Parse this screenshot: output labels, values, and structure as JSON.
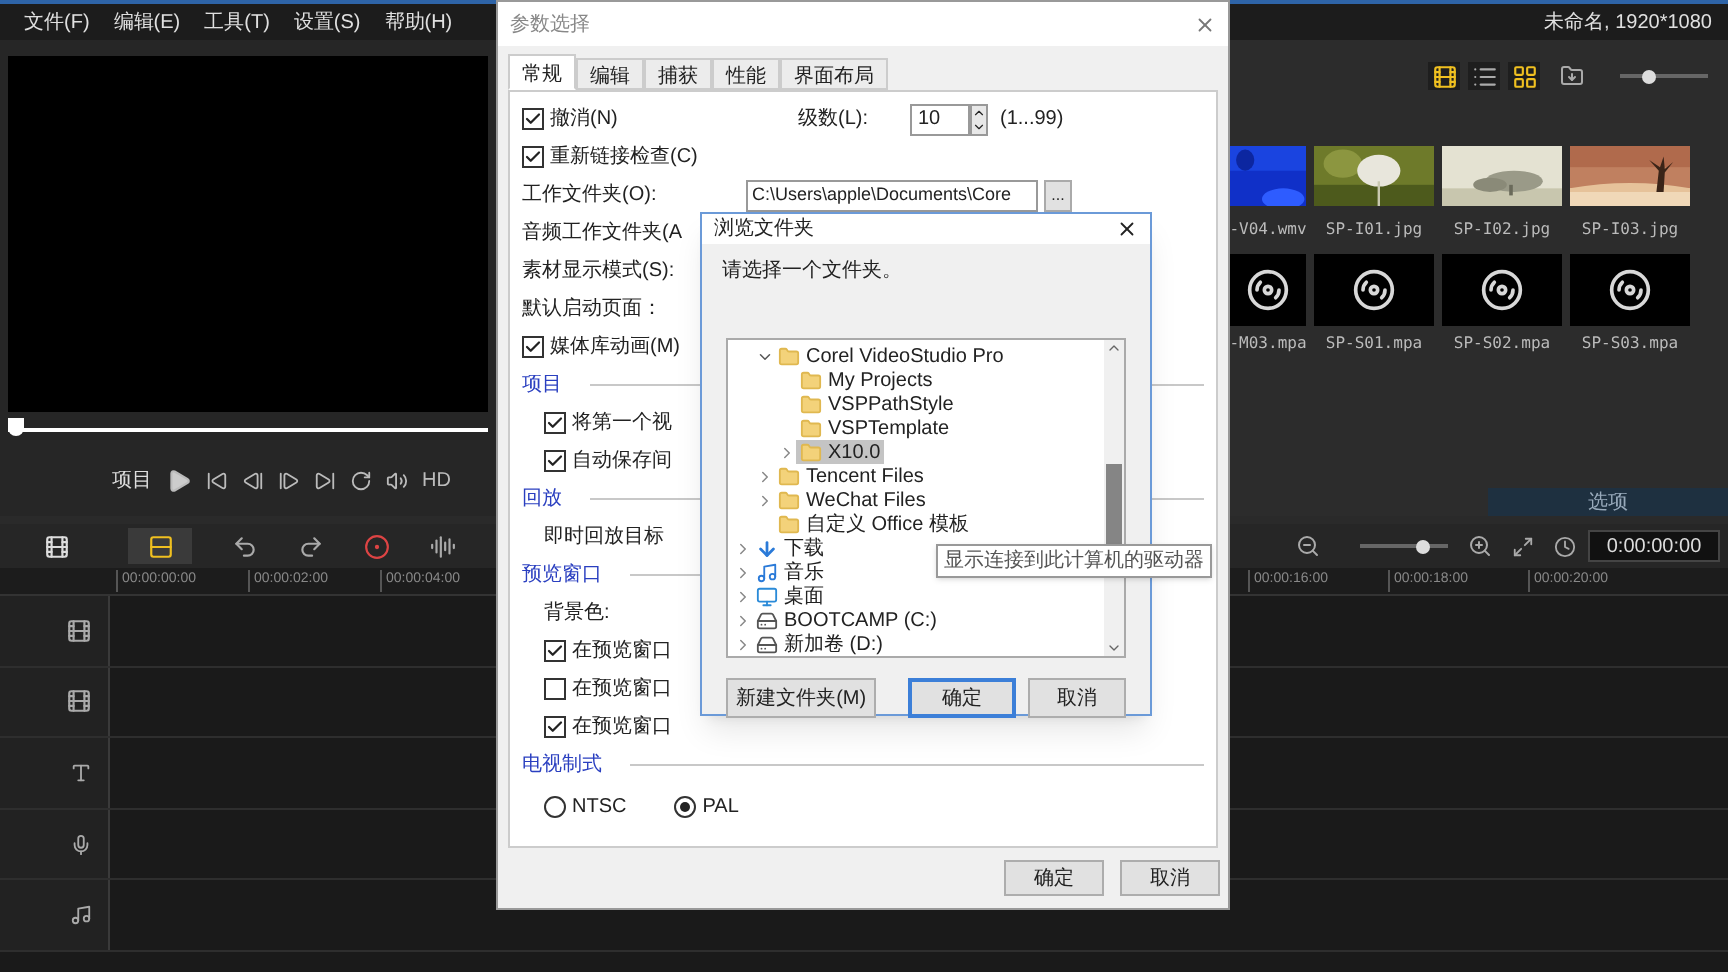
{
  "menu": [
    "文件(F)",
    "编辑(E)",
    "工具(T)",
    "设置(S)",
    "帮助(H)"
  ],
  "project_info": "未命名, 1920*1080",
  "preview": {
    "scrubber": {
      "level": 0
    },
    "mode_label": "项目",
    "hd_label": "HD"
  },
  "library": {
    "view_buttons": [
      {
        "kind": "storyboard",
        "selected": true
      },
      {
        "kind": "list",
        "selected": false
      },
      {
        "kind": "grid",
        "selected": true
      }
    ],
    "thumb_slider": {
      "level": 0.3
    },
    "items": [
      {
        "kind": "video",
        "label": "-V04.wmv"
      },
      {
        "label": "SP-I01.jpg"
      },
      {
        "label": "SP-I02.jpg"
      },
      {
        "label": "SP-I03.jpg"
      },
      {
        "kind": "audio",
        "label": "-M03.mpa"
      },
      {
        "kind": "audio",
        "label": "SP-S01.mpa"
      },
      {
        "kind": "audio",
        "label": "SP-S02.mpa"
      },
      {
        "kind": "audio",
        "label": "SP-S03.mpa"
      }
    ],
    "options_tab": "选项"
  },
  "timeline": {
    "view_buttons": [
      {
        "kind": "storyboard",
        "selected": false
      },
      {
        "kind": "timeline",
        "selected": true
      }
    ],
    "zoom_slider": {
      "level": 0.75
    },
    "timecode": "0:00:00:00",
    "ruler_left": [
      "00:00:00:00",
      "00:00:02:00",
      "00:00:04:00"
    ],
    "ruler_right": [
      "00:00:16:00",
      "00:00:18:00",
      "00:00:20:00"
    ],
    "tracks": [
      {
        "kind": "video"
      },
      {
        "kind": "overlay"
      },
      {
        "kind": "title"
      },
      {
        "kind": "voice"
      },
      {
        "kind": "music"
      }
    ]
  },
  "preferences": {
    "title": "参数选择",
    "tabs": [
      {
        "label": "常规",
        "selected": true
      },
      {
        "label": "编辑",
        "selected": false
      },
      {
        "label": "捕获",
        "selected": false
      },
      {
        "label": "性能",
        "selected": false
      },
      {
        "label": "界面布局",
        "selected": false
      }
    ],
    "rows": [
      {
        "kind": "checkbox_spinner",
        "label": "撤消(N)",
        "checked": true,
        "spinner_label": "级数(L):",
        "value": "10",
        "range": "(1...99)"
      },
      {
        "kind": "checkbox",
        "label": "重新链接检查(C)",
        "checked": true
      },
      {
        "kind": "path",
        "label": "工作文件夹(O):",
        "value": "C:\\Users\\apple\\Documents\\Core",
        "button": "..."
      },
      {
        "kind": "label",
        "label": "音频工作文件夹(A"
      },
      {
        "kind": "label",
        "label": "素材显示模式(S):"
      },
      {
        "kind": "label",
        "label": "默认启动页面："
      },
      {
        "kind": "checkbox",
        "label": "媒体库动画(M)",
        "checked": true
      },
      {
        "kind": "section",
        "label": "项目",
        "children": [
          {
            "kind": "checkbox",
            "label": "将第一个视",
            "checked": true
          },
          {
            "kind": "checkbox",
            "label": "自动保存间",
            "checked": true
          }
        ]
      },
      {
        "kind": "section",
        "label": "回放",
        "children": [
          {
            "kind": "label",
            "label": "即时回放目标"
          }
        ]
      },
      {
        "kind": "section",
        "label": "预览窗口",
        "children": [
          {
            "kind": "label",
            "label": "背景色:"
          },
          {
            "kind": "checkbox",
            "label": "在预览窗口",
            "checked": true
          },
          {
            "kind": "checkbox",
            "label": "在预览窗口",
            "checked": false
          },
          {
            "kind": "checkbox",
            "label": "在预览窗口",
            "checked": true
          }
        ]
      },
      {
        "kind": "section",
        "label": "电视制式",
        "children": [
          {
            "kind": "radio_group",
            "options": [
              {
                "label": "NTSC",
                "selected": false
              },
              {
                "label": "PAL",
                "selected": true
              }
            ]
          }
        ]
      }
    ],
    "buttons": [
      "确定",
      "取消"
    ]
  },
  "browse": {
    "title": "浏览文件夹",
    "prompt": "请选择一个文件夹。",
    "tree": [
      {
        "children": [
          {
            "kind": "folder",
            "label": "Corel VideoStudio Pro",
            "expanded": true,
            "selected": false,
            "children": [
              {
                "kind": "folder",
                "label": "My Projects",
                "selected": false
              },
              {
                "kind": "folder",
                "label": "VSPPathStyle",
                "selected": false
              },
              {
                "kind": "folder",
                "label": "VSPTemplate",
                "selected": false
              },
              {
                "kind": "folder",
                "label": "X10.0",
                "expanded": false,
                "selected": true
              }
            ]
          },
          {
            "kind": "folder",
            "label": "Tencent Files",
            "expanded": false,
            "selected": false
          },
          {
            "kind": "folder",
            "label": "WeChat Files",
            "expanded": false,
            "selected": false
          },
          {
            "kind": "folder",
            "label": "自定义 Office 模板",
            "selected": false
          }
        ]
      },
      {
        "kind": "download",
        "label": "下载",
        "expanded": false,
        "selected": false
      },
      {
        "kind": "music",
        "label": "音乐",
        "expanded": false,
        "selected": false
      },
      {
        "kind": "desktop",
        "label": "桌面",
        "expanded": false,
        "selected": false
      },
      {
        "kind": "drive",
        "label": "BOOTCAMP (C:)",
        "expanded": false,
        "selected": false
      },
      {
        "kind": "drive",
        "label": "新加卷 (D:)",
        "expanded": false,
        "selected": false
      }
    ],
    "buttons": [
      {
        "label": "新建文件夹(M)",
        "focused": false
      },
      {
        "label": "确定",
        "focused": true
      },
      {
        "label": "取消",
        "focused": false
      }
    ],
    "tooltip": "显示连接到此计算机的驱动器"
  }
}
